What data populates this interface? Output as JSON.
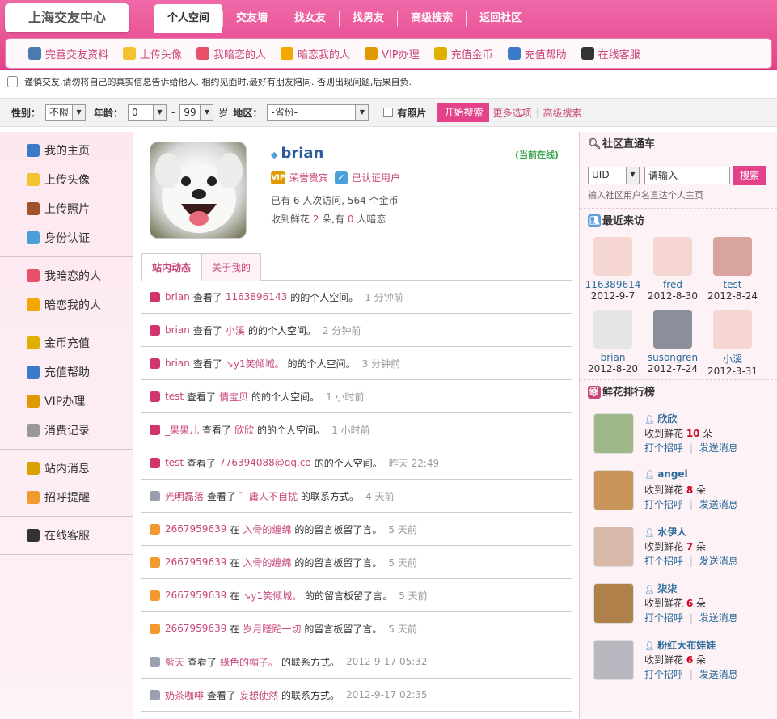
{
  "header": {
    "logo": "上海交友中心",
    "nav": [
      "个人空间",
      "交友墙",
      "找女友",
      "找男友",
      "高级搜索",
      "返回社区"
    ],
    "subnav": [
      {
        "icon": "profile-icon",
        "label": "完善交友资料",
        "color": "#4a7ab0"
      },
      {
        "icon": "smiley-icon",
        "label": "上传头像",
        "color": "#f2c230"
      },
      {
        "icon": "heart-icon",
        "label": "我暗恋的人",
        "color": "#e8506a"
      },
      {
        "icon": "star-icon",
        "label": "暗恋我的人",
        "color": "#f4a700"
      },
      {
        "icon": "vip-icon",
        "label": "VIP办理",
        "color": "#e09a00"
      },
      {
        "icon": "coins-icon",
        "label": "充值金币",
        "color": "#e0b000"
      },
      {
        "icon": "info-icon",
        "label": "充值帮助",
        "color": "#3a7ac8"
      },
      {
        "icon": "qq-icon",
        "label": "在线客服",
        "color": "#333333"
      }
    ]
  },
  "notice": "谨慎交友,请勿将自己的真实信息告诉给他人. 相约见面时,最好有朋友陪同. 否则出现问题,后果自负.",
  "search": {
    "gender_label": "性别：",
    "gender": "不限",
    "age_label": "年龄：",
    "age_from": "0",
    "dash": "-",
    "age_to": "99",
    "age_unit": "岁",
    "area_label": "地区：",
    "area": "-省份-",
    "photo_label": "有照片",
    "submit": "开始搜索",
    "more": "更多选项",
    "adv": "高级搜索"
  },
  "sidebar": [
    [
      {
        "icon": "home-icon",
        "label": "我的主页",
        "color": "#3a7ac8"
      },
      {
        "icon": "smiley-icon",
        "label": "上传头像",
        "color": "#f2c230"
      },
      {
        "icon": "photo-icon",
        "label": "上传照片",
        "color": "#a0522d"
      },
      {
        "icon": "verify-icon",
        "label": "身份认证",
        "color": "#4aa0d8"
      }
    ],
    [
      {
        "icon": "heart-icon",
        "label": "我暗恋的人",
        "color": "#e8506a"
      },
      {
        "icon": "star-icon",
        "label": "暗恋我的人",
        "color": "#f4a700"
      }
    ],
    [
      {
        "icon": "coins-icon",
        "label": "金币充值",
        "color": "#e0b000"
      },
      {
        "icon": "info-icon",
        "label": "充值帮助",
        "color": "#3a7ac8"
      },
      {
        "icon": "vip-icon",
        "label": "VIP办理",
        "color": "#e09a00"
      },
      {
        "icon": "record-icon",
        "label": "消费记录",
        "color": "#999999"
      }
    ],
    [
      {
        "icon": "pencil-icon",
        "label": "站内消息",
        "color": "#d8a000"
      },
      {
        "icon": "chat-icon",
        "label": "招呼提醒",
        "color": "#f09a30"
      }
    ],
    [
      {
        "icon": "qq-icon",
        "label": "在线客服",
        "color": "#333333"
      }
    ]
  ],
  "profile": {
    "name": "brian",
    "status": "(当前在线)",
    "badge1": "荣誉贵宾",
    "badge2": "已认证用户",
    "stat1": "已有 6 人次访问, 564 个金币",
    "stat2_pre": "收到鲜花 ",
    "stat2_n1": "2",
    "stat2_mid": " 朵,有 ",
    "stat2_n2": "0",
    "stat2_post": " 人暗恋"
  },
  "tabs": [
    "站内动态",
    "关于我的"
  ],
  "feed": [
    {
      "icon": "view-icon",
      "user": "brian",
      "verb": "查看了",
      "target": "1163896143",
      "suffix": "的的个人空间。",
      "time": "1 分钟前",
      "color": "#d0356e"
    },
    {
      "icon": "view-icon",
      "user": "brian",
      "verb": "查看了",
      "target": "小溪",
      "suffix": "的的个人空间。",
      "time": "2 分钟前",
      "color": "#d0356e"
    },
    {
      "icon": "view-icon",
      "user": "brian",
      "verb": "查看了",
      "target": "↘y1笑倾城。",
      "suffix": "的的个人空间。",
      "time": "3 分钟前",
      "color": "#d0356e"
    },
    {
      "icon": "view-icon",
      "user": "test",
      "verb": "查看了",
      "target": "情宝贝",
      "suffix": "的的个人空间。",
      "time": "1 小时前",
      "color": "#d0356e"
    },
    {
      "icon": "view-icon",
      "user": "_果果儿",
      "verb": "查看了",
      "target": "欣欣",
      "suffix": "的的个人空间。",
      "time": "1 小时前",
      "color": "#d0356e"
    },
    {
      "icon": "view-icon",
      "user": "test",
      "verb": "查看了",
      "target": "776394088@qq.co",
      "suffix": "的的个人空间。",
      "time": "昨天 22:49",
      "color": "#d0356e"
    },
    {
      "icon": "contact-icon",
      "user": "光明磊落",
      "verb": "查看了",
      "target": "゛庸人不自扰",
      "suffix": "的联系方式。",
      "time": "4 天前",
      "color": "#9aa0b0"
    },
    {
      "icon": "comment-icon",
      "user": "2667959639",
      "verb": "在",
      "target": "入骨的缠绵",
      "suffix": "的的留言板留了言。",
      "time": "5 天前",
      "color": "#f09a30"
    },
    {
      "icon": "comment-icon",
      "user": "2667959639",
      "verb": "在",
      "target": "入骨的缠绵",
      "suffix": "的的留言板留了言。",
      "time": "5 天前",
      "color": "#f09a30"
    },
    {
      "icon": "comment-icon",
      "user": "2667959639",
      "verb": "在",
      "target": "↘y1笑倾城。",
      "suffix": "的的留言板留了言。",
      "time": "5 天前",
      "color": "#f09a30"
    },
    {
      "icon": "comment-icon",
      "user": "2667959639",
      "verb": "在",
      "target": "岁月蹉跎一切",
      "suffix": "的留言板留了言。",
      "time": "5 天前",
      "color": "#f09a30"
    },
    {
      "icon": "contact-icon",
      "user": "藍天",
      "verb": "查看了",
      "target": "綠色的帽子。",
      "suffix": "的联系方式。",
      "time": "2012-9-17 05:32",
      "color": "#9aa0b0"
    },
    {
      "icon": "contact-icon",
      "user": "奶茶咖啡",
      "verb": "查看了",
      "target": "妄想使然",
      "suffix": "的联系方式。",
      "time": "2012-9-17 02:35",
      "color": "#9aa0b0"
    }
  ],
  "right": {
    "title1": "社区直通车",
    "uid": "UID",
    "placeholder": "请输入",
    "btn": "搜索",
    "hint": "输入社区用户名直达个人主页",
    "title2": "最近来访",
    "visitors": [
      {
        "name": "116389614",
        "date": "2012-9-7",
        "bg": "#f6d6d0"
      },
      {
        "name": "fred",
        "date": "2012-8-30",
        "bg": "#f6d6d0"
      },
      {
        "name": "test",
        "date": "2012-8-24",
        "bg": "#d9a3a0"
      },
      {
        "name": "brian",
        "date": "2012-8-20",
        "bg": "#e6e6e6"
      },
      {
        "name": "susongren",
        "date": "2012-7-24",
        "bg": "#8a8f99"
      },
      {
        "name": "小溪",
        "date": "2012-3-31",
        "bg": "#f6d6d0"
      }
    ],
    "title3": "鲜花排行榜",
    "ranks": [
      {
        "name": "欣欣",
        "pre": "收到鲜花 ",
        "n": "10",
        "post": " 朵",
        "a1": "打个招呼",
        "a2": "发送消息",
        "bg": "#9fb88a"
      },
      {
        "name": "angel",
        "pre": "收到鲜花 ",
        "n": "8",
        "post": " 朵",
        "a1": "打个招呼",
        "a2": "发送消息",
        "bg": "#c9955a"
      },
      {
        "name": "水伊人",
        "pre": "收到鲜花 ",
        "n": "7",
        "post": " 朵",
        "a1": "打个招呼",
        "a2": "发送消息",
        "bg": "#d8b8a8"
      },
      {
        "name": "柒柒",
        "pre": "收到鲜花 ",
        "n": "6",
        "post": " 朵",
        "a1": "打个招呼",
        "a2": "发送消息",
        "bg": "#b0804a"
      },
      {
        "name": "粉红大布娃娃",
        "pre": "收到鲜花 ",
        "n": "6",
        "post": " 朵",
        "a1": "打个招呼",
        "a2": "发送消息",
        "bg": "#b8b8c0"
      }
    ]
  }
}
